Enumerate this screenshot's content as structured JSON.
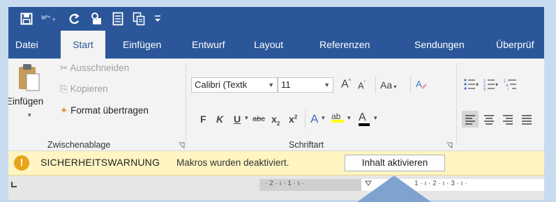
{
  "colors": {
    "word_blue": "#2b579a",
    "ribbon_bg": "#f3f3f3",
    "warning_bg": "#fff4c2",
    "warning_icon": "#e8a317",
    "frame_bg": "#c9dcef",
    "callout_blue": "#7ea3cf"
  },
  "qat": {
    "icons": [
      "save-icon",
      "undo-icon",
      "redo-icon",
      "touch-mode-icon",
      "document-icon",
      "copy-format-icon",
      "customize-icon"
    ]
  },
  "tabs": [
    {
      "label": "Datei"
    },
    {
      "label": "Start",
      "active": true
    },
    {
      "label": "Einfügen"
    },
    {
      "label": "Entwurf"
    },
    {
      "label": "Layout"
    },
    {
      "label": "Referenzen"
    },
    {
      "label": "Sendungen"
    },
    {
      "label": "Überprüf"
    }
  ],
  "clipboard": {
    "paste_label": "Einfügen",
    "cut_label": "Ausschneiden",
    "copy_label": "Kopieren",
    "format_painter_label": "Format übertragen",
    "group_label": "Zwischenablage"
  },
  "font": {
    "font_name": "Calibri (Textk",
    "font_size": "11",
    "grow_label": "A",
    "shrink_label": "A",
    "case_label": "Aa",
    "bold": "F",
    "italic": "K",
    "underline": "U",
    "strike": "abc",
    "subscript": "x",
    "superscript": "x",
    "text_effects": "A",
    "highlight": "ab",
    "font_color": "A",
    "group_label": "Schriftart"
  },
  "security": {
    "title": "SICHERHEITSWARNUNG",
    "message": "Makros wurden deaktiviert.",
    "button": "Inhalt aktivieren"
  },
  "ruler": {
    "left_ticks": "· 2 · ı · 1 · ı ·",
    "right_ticks": "1 · ı · 2 · ı · 3 · ı ·",
    "corner": "L"
  }
}
